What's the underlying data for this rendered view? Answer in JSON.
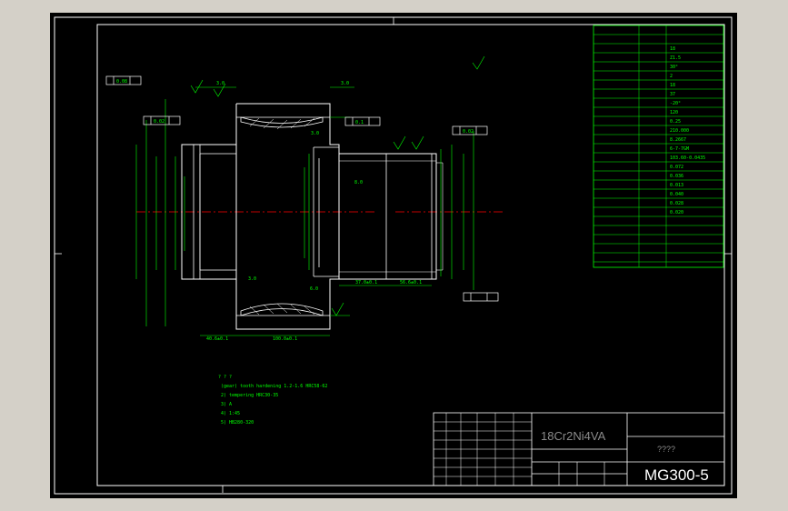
{
  "title_block": {
    "material": "18Cr2Ni4VA",
    "drawing_no": "MG300-5",
    "title_placeholder": "????"
  },
  "dimensions": {
    "left_width": "40.6±0.1",
    "overall_length": "100.0±0.1",
    "right_step_a": "37.0±0.1",
    "right_step_b": "56.6±0.1",
    "top_left_offset": "3.0",
    "top_right_offset": "3.0",
    "chamfer_a": "3.0",
    "chamfer_b": "6.0",
    "mid_offset": "8.0",
    "gear_mark": "3.0",
    "ref_a": "0.08",
    "ref_b": "0.1",
    "ref_c": "0.02",
    "ref_d": "0.02"
  },
  "gear_table": {
    "rows": [
      "18",
      "Z1.5",
      "30°",
      "2",
      "18",
      "37",
      "-20°",
      "120",
      "0.25",
      "210.000",
      "8.2667",
      "6-7-7GM",
      "103.60-0.0435",
      "0.072",
      "0.036",
      "0.013",
      "0.040",
      "0.028",
      "0.020"
    ]
  },
  "notes": {
    "line1": "(gear) tooth hardening 1.2-1.6  HRC58-62",
    "line2": "2) tempering HRC30-35",
    "line3": "3) A",
    "line4": "4) 1:45",
    "line5": "5) HB280-320"
  }
}
